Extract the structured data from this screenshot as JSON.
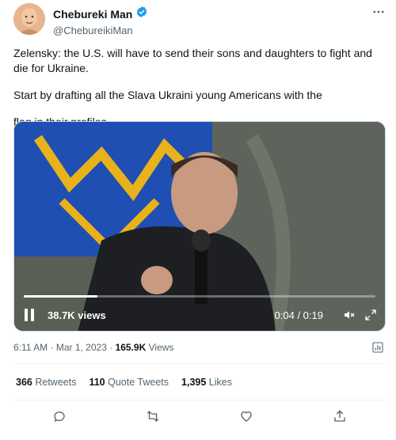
{
  "author": {
    "display_name": "Chebureki Man",
    "handle": "@ChebureikiMan",
    "verified": true
  },
  "tweet": {
    "paragraphs": [
      "Zelensky: the U.S. will have to send their sons and daughters to fight and die for Ukraine.",
      "Start by drafting all the Slava Ukraini young Americans with the",
      "flag in their profiles."
    ]
  },
  "video": {
    "views": "38.7K views",
    "time": "0:04 / 0:19",
    "progress": 0.21
  },
  "meta": {
    "time": "6:11 AM",
    "date": "Mar 1, 2023",
    "views_count": "165.9K",
    "views_label": "Views"
  },
  "stats": {
    "retweets_count": "366",
    "retweets_label": "Retweets",
    "quotes_count": "110",
    "quotes_label": "Quote Tweets",
    "likes_count": "1,395",
    "likes_label": "Likes"
  },
  "colors": {
    "verified_blue": "#1d9bf0",
    "muted_text": "#536471",
    "flag_blue": "#0057b7",
    "flag_yellow": "#ffd700"
  },
  "icons": [
    "more-icon",
    "verified-badge-icon",
    "ukraine-flag-icon",
    "pause-icon",
    "volume-icon",
    "fullscreen-icon",
    "analytics-icon",
    "reply-icon",
    "retweet-icon",
    "like-icon",
    "share-icon"
  ]
}
